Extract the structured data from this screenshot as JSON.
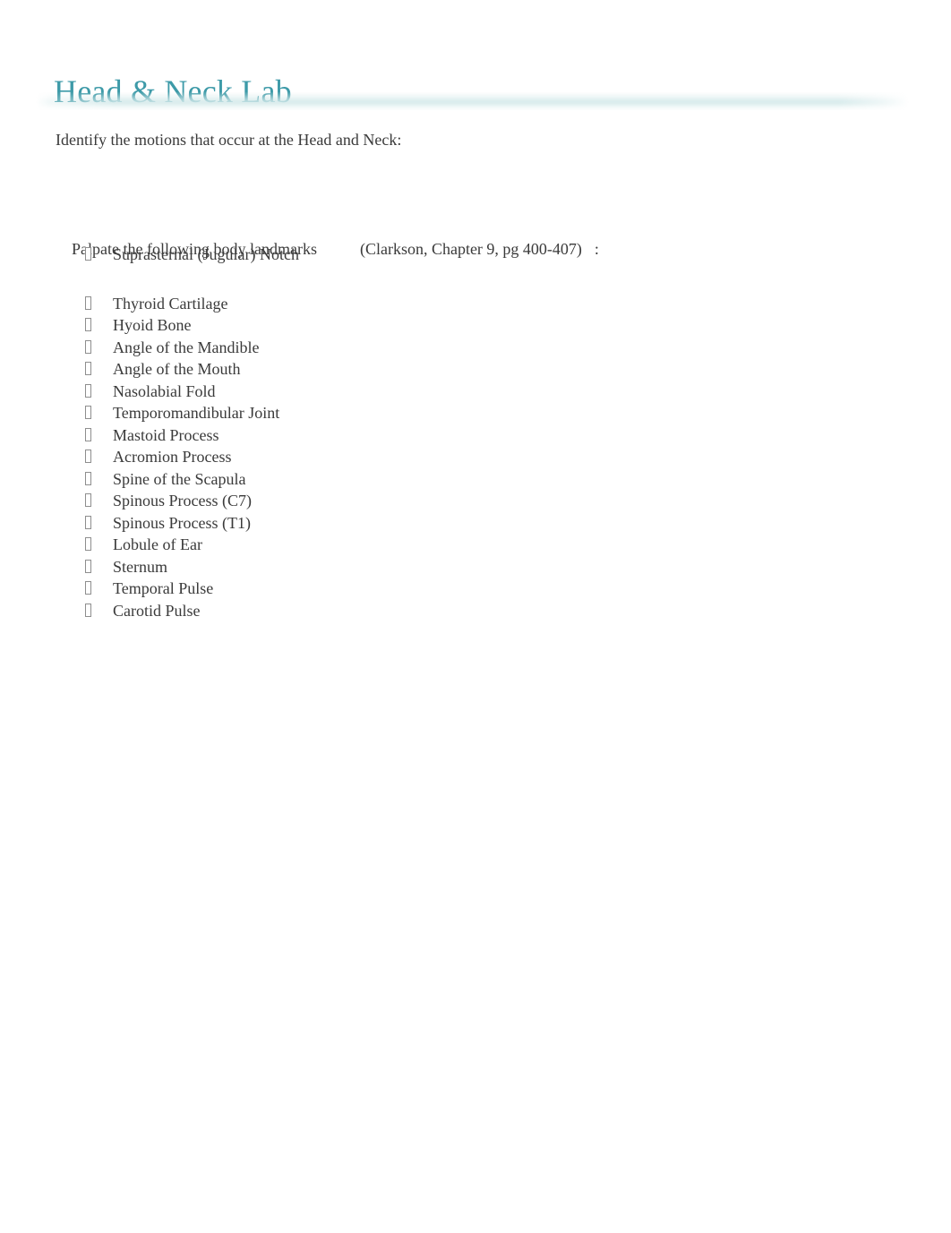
{
  "document": {
    "title": "Head & Neck Lab",
    "title_color": "#3d9aa8",
    "body_color": "#3a3a3a",
    "page_background": "#ffffff",
    "rule_color": "#cfe7e8"
  },
  "intro": {
    "prompt": "Identify the motions that occur at the Head and Neck:"
  },
  "palpate": {
    "instruction": "Palpate the following body landmarks",
    "citation": "(Clarkson, Chapter 9, pg 400-407)",
    "colon": ":"
  },
  "landmarks": {
    "marker_glyph": "missing-glyph-box",
    "items": [
      {
        "label": "Suprasternal (Jugular) Notch",
        "gap_after": true
      },
      {
        "label": "Thyroid Cartilage",
        "gap_after": false
      },
      {
        "label": "Hyoid Bone",
        "gap_after": false
      },
      {
        "label": "Angle of the Mandible",
        "gap_after": false
      },
      {
        "label": "Angle of the Mouth",
        "gap_after": false
      },
      {
        "label": "Nasolabial Fold",
        "gap_after": false
      },
      {
        "label": "Temporomandibular Joint",
        "gap_after": false
      },
      {
        "label": "Mastoid Process",
        "gap_after": false
      },
      {
        "label": "Acromion Process",
        "gap_after": false
      },
      {
        "label": "Spine of the Scapula",
        "gap_after": false
      },
      {
        "label": "Spinous Process (C7)",
        "gap_after": false
      },
      {
        "label": "Spinous Process (T1)",
        "gap_after": false
      },
      {
        "label": "Lobule of Ear",
        "gap_after": false
      },
      {
        "label": "Sternum",
        "gap_after": false
      },
      {
        "label": "Temporal Pulse",
        "gap_after": false
      },
      {
        "label": "Carotid Pulse",
        "gap_after": false
      }
    ]
  }
}
